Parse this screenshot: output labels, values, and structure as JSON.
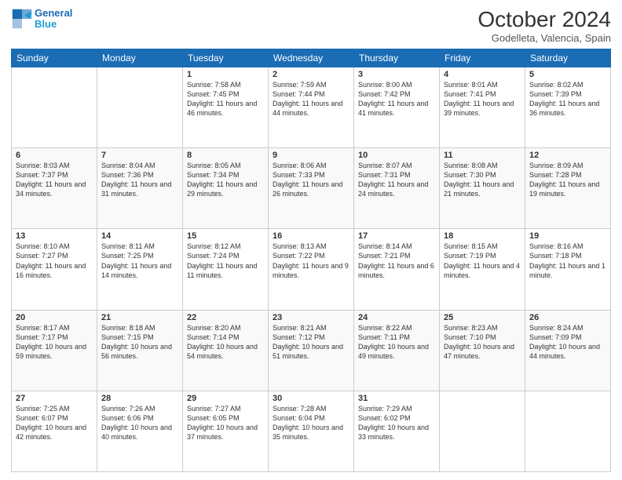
{
  "header": {
    "logo_line1": "General",
    "logo_line2": "Blue",
    "month_year": "October 2024",
    "location": "Godelleta, Valencia, Spain"
  },
  "days_of_week": [
    "Sunday",
    "Monday",
    "Tuesday",
    "Wednesday",
    "Thursday",
    "Friday",
    "Saturday"
  ],
  "weeks": [
    [
      {
        "day": "",
        "info": ""
      },
      {
        "day": "",
        "info": ""
      },
      {
        "day": "1",
        "info": "Sunrise: 7:58 AM\nSunset: 7:45 PM\nDaylight: 11 hours and 46 minutes."
      },
      {
        "day": "2",
        "info": "Sunrise: 7:59 AM\nSunset: 7:44 PM\nDaylight: 11 hours and 44 minutes."
      },
      {
        "day": "3",
        "info": "Sunrise: 8:00 AM\nSunset: 7:42 PM\nDaylight: 11 hours and 41 minutes."
      },
      {
        "day": "4",
        "info": "Sunrise: 8:01 AM\nSunset: 7:41 PM\nDaylight: 11 hours and 39 minutes."
      },
      {
        "day": "5",
        "info": "Sunrise: 8:02 AM\nSunset: 7:39 PM\nDaylight: 11 hours and 36 minutes."
      }
    ],
    [
      {
        "day": "6",
        "info": "Sunrise: 8:03 AM\nSunset: 7:37 PM\nDaylight: 11 hours and 34 minutes."
      },
      {
        "day": "7",
        "info": "Sunrise: 8:04 AM\nSunset: 7:36 PM\nDaylight: 11 hours and 31 minutes."
      },
      {
        "day": "8",
        "info": "Sunrise: 8:05 AM\nSunset: 7:34 PM\nDaylight: 11 hours and 29 minutes."
      },
      {
        "day": "9",
        "info": "Sunrise: 8:06 AM\nSunset: 7:33 PM\nDaylight: 11 hours and 26 minutes."
      },
      {
        "day": "10",
        "info": "Sunrise: 8:07 AM\nSunset: 7:31 PM\nDaylight: 11 hours and 24 minutes."
      },
      {
        "day": "11",
        "info": "Sunrise: 8:08 AM\nSunset: 7:30 PM\nDaylight: 11 hours and 21 minutes."
      },
      {
        "day": "12",
        "info": "Sunrise: 8:09 AM\nSunset: 7:28 PM\nDaylight: 11 hours and 19 minutes."
      }
    ],
    [
      {
        "day": "13",
        "info": "Sunrise: 8:10 AM\nSunset: 7:27 PM\nDaylight: 11 hours and 16 minutes."
      },
      {
        "day": "14",
        "info": "Sunrise: 8:11 AM\nSunset: 7:25 PM\nDaylight: 11 hours and 14 minutes."
      },
      {
        "day": "15",
        "info": "Sunrise: 8:12 AM\nSunset: 7:24 PM\nDaylight: 11 hours and 11 minutes."
      },
      {
        "day": "16",
        "info": "Sunrise: 8:13 AM\nSunset: 7:22 PM\nDaylight: 11 hours and 9 minutes."
      },
      {
        "day": "17",
        "info": "Sunrise: 8:14 AM\nSunset: 7:21 PM\nDaylight: 11 hours and 6 minutes."
      },
      {
        "day": "18",
        "info": "Sunrise: 8:15 AM\nSunset: 7:19 PM\nDaylight: 11 hours and 4 minutes."
      },
      {
        "day": "19",
        "info": "Sunrise: 8:16 AM\nSunset: 7:18 PM\nDaylight: 11 hours and 1 minute."
      }
    ],
    [
      {
        "day": "20",
        "info": "Sunrise: 8:17 AM\nSunset: 7:17 PM\nDaylight: 10 hours and 59 minutes."
      },
      {
        "day": "21",
        "info": "Sunrise: 8:18 AM\nSunset: 7:15 PM\nDaylight: 10 hours and 56 minutes."
      },
      {
        "day": "22",
        "info": "Sunrise: 8:20 AM\nSunset: 7:14 PM\nDaylight: 10 hours and 54 minutes."
      },
      {
        "day": "23",
        "info": "Sunrise: 8:21 AM\nSunset: 7:12 PM\nDaylight: 10 hours and 51 minutes."
      },
      {
        "day": "24",
        "info": "Sunrise: 8:22 AM\nSunset: 7:11 PM\nDaylight: 10 hours and 49 minutes."
      },
      {
        "day": "25",
        "info": "Sunrise: 8:23 AM\nSunset: 7:10 PM\nDaylight: 10 hours and 47 minutes."
      },
      {
        "day": "26",
        "info": "Sunrise: 8:24 AM\nSunset: 7:09 PM\nDaylight: 10 hours and 44 minutes."
      }
    ],
    [
      {
        "day": "27",
        "info": "Sunrise: 7:25 AM\nSunset: 6:07 PM\nDaylight: 10 hours and 42 minutes."
      },
      {
        "day": "28",
        "info": "Sunrise: 7:26 AM\nSunset: 6:06 PM\nDaylight: 10 hours and 40 minutes."
      },
      {
        "day": "29",
        "info": "Sunrise: 7:27 AM\nSunset: 6:05 PM\nDaylight: 10 hours and 37 minutes."
      },
      {
        "day": "30",
        "info": "Sunrise: 7:28 AM\nSunset: 6:04 PM\nDaylight: 10 hours and 35 minutes."
      },
      {
        "day": "31",
        "info": "Sunrise: 7:29 AM\nSunset: 6:02 PM\nDaylight: 10 hours and 33 minutes."
      },
      {
        "day": "",
        "info": ""
      },
      {
        "day": "",
        "info": ""
      }
    ]
  ]
}
